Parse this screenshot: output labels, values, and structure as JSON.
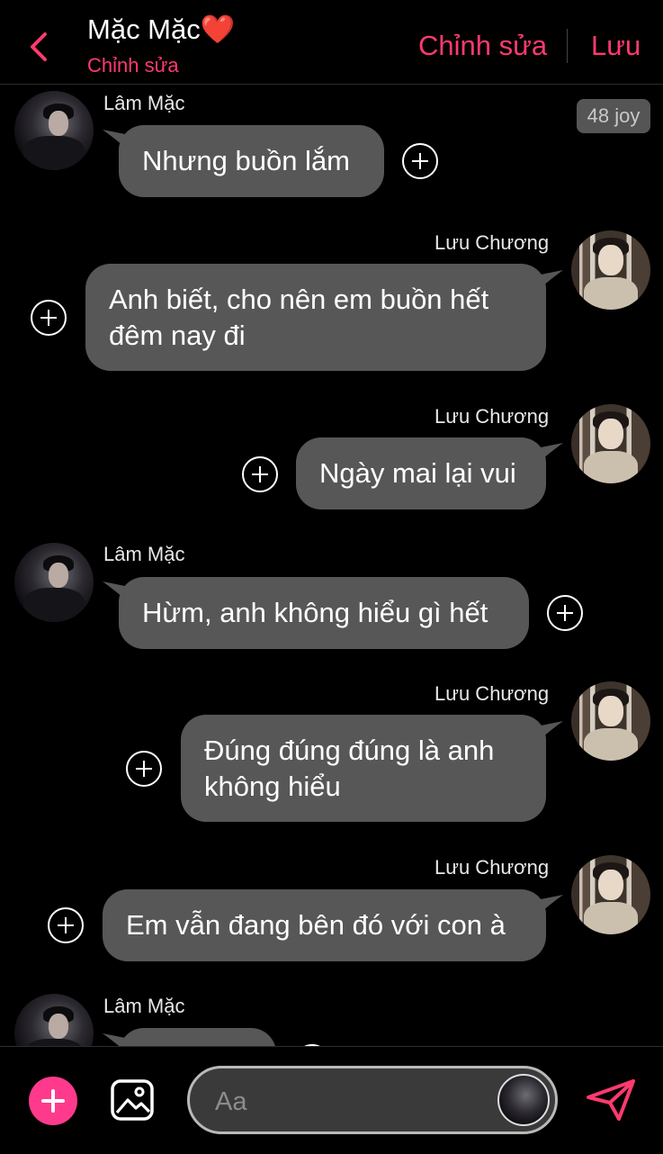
{
  "header": {
    "title": "Mặc Mặc❤️",
    "subtitle": "Chỉnh sửa",
    "edit_label": "Chỉnh sửa",
    "save_label": "Lưu"
  },
  "joy_badge": "48 joy",
  "messages": [
    {
      "sender": "Lâm Mặc",
      "side": "left",
      "text": "Nhưng buồn lắm"
    },
    {
      "sender": "Lưu Chương",
      "side": "right",
      "text": "Anh biết, cho nên em buồn hết đêm nay đi"
    },
    {
      "sender": "Lưu Chương",
      "side": "right",
      "text": "Ngày mai lại vui"
    },
    {
      "sender": "Lâm Mặc",
      "side": "left",
      "text": "Hừm, anh không hiểu gì hết"
    },
    {
      "sender": "Lưu Chương",
      "side": "right",
      "text": "Đúng đúng đúng là anh không hiểu"
    },
    {
      "sender": "Lưu Chương",
      "side": "right",
      "text": "Em vẫn đang bên đó với con à"
    },
    {
      "sender": "Lâm Mặc",
      "side": "left",
      "text": ""
    }
  ],
  "composer": {
    "placeholder": "Aa"
  },
  "colors": {
    "accent": "#ff3a6e",
    "bubble": "#575757",
    "background": "#000000"
  }
}
